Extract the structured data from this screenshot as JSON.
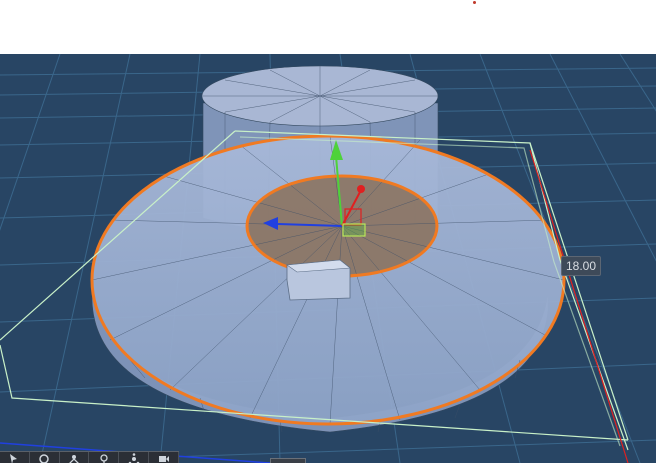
{
  "viewport": {
    "dimension_label": "18.00",
    "colors": {
      "background": "#284564",
      "grid": "#3c6a8f",
      "selection_outline": "#f07a22",
      "bounding_box": "#c8f0c8",
      "axis_x": "#e02020",
      "axis_y": "#4ed23a",
      "axis_z": "#2040e0",
      "mesh": "#8fa6cc"
    }
  },
  "toolbar": {
    "buttons": [
      {
        "icon": "select-icon"
      },
      {
        "icon": "orbit-icon"
      },
      {
        "icon": "pan-icon"
      },
      {
        "icon": "light-icon"
      },
      {
        "icon": "hierarchy-icon"
      },
      {
        "icon": "camera-icon"
      }
    ]
  }
}
